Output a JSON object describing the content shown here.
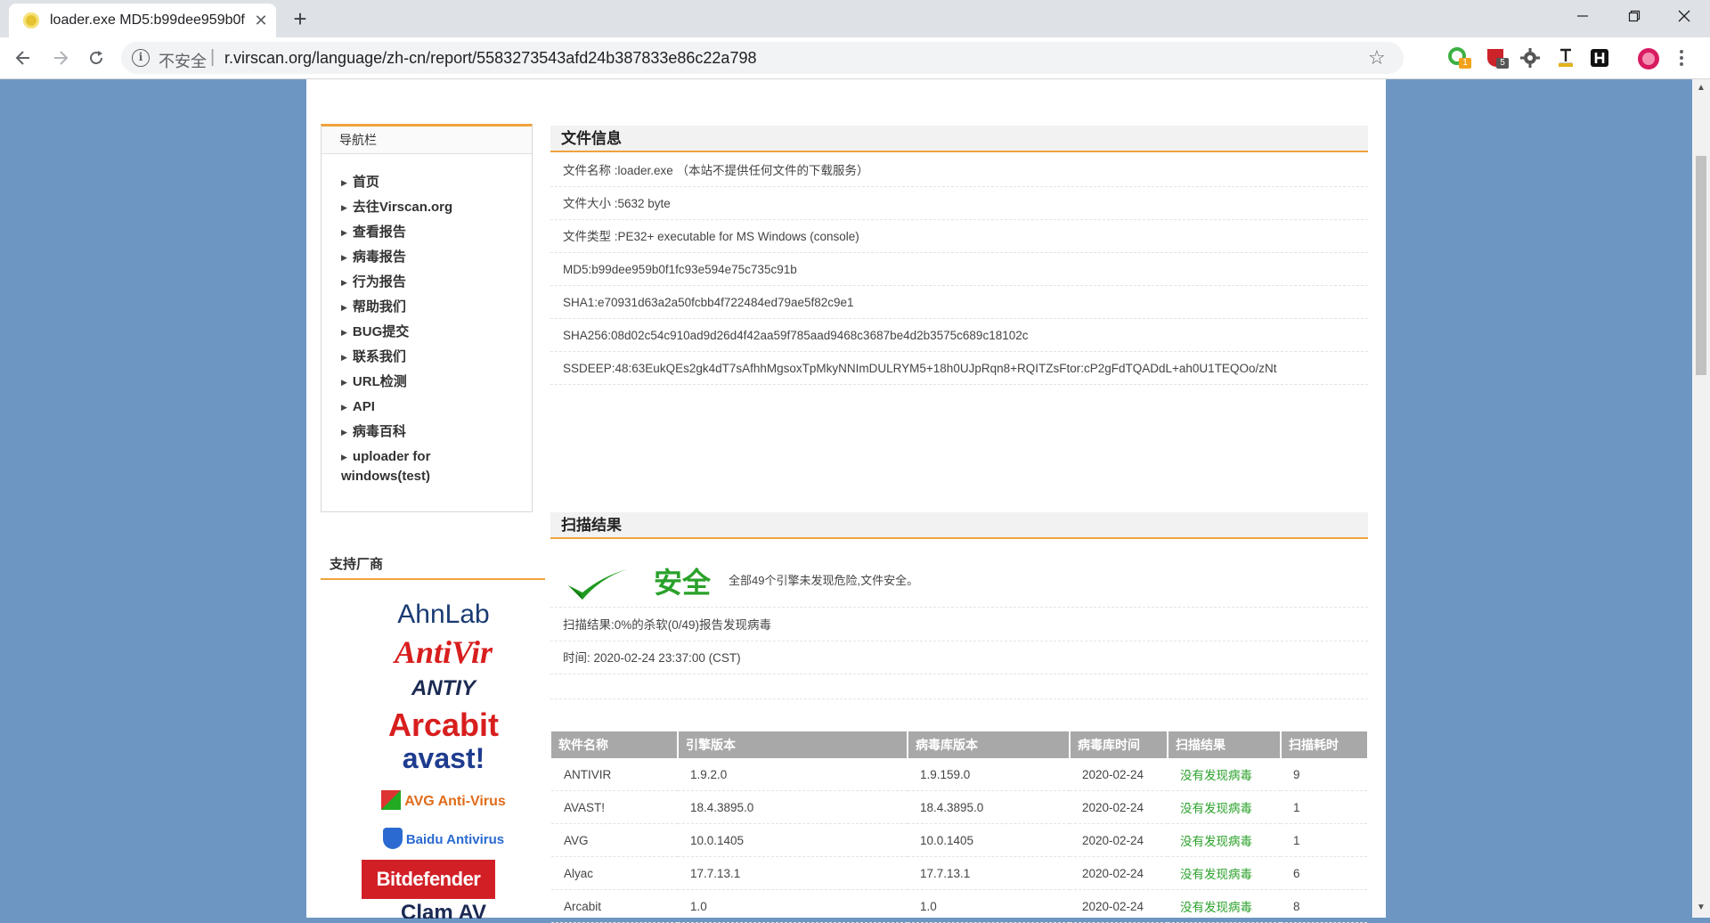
{
  "browser": {
    "tab_title": "loader.exe MD5:b99dee959b0f",
    "tab_close": "✕",
    "new_tab": "+",
    "omnibox": {
      "security_label": "不安全",
      "url": "r.virscan.org/language/zh-cn/report/5583273543afd24b387833e86c22a798"
    },
    "extensions": [
      {
        "name": "extension-1",
        "badge": "1",
        "badge_color": "#f1a11b",
        "color": "#3cb043"
      },
      {
        "name": "extension-2",
        "badge": "5",
        "badge_color": "#555555",
        "color": "#cc2229"
      },
      {
        "name": "extension-3",
        "badge": "",
        "color": "#555555"
      },
      {
        "name": "extension-4",
        "badge": "",
        "color": "#e3b21b"
      },
      {
        "name": "extension-5",
        "badge": "",
        "color": "#111111"
      }
    ]
  },
  "nav": {
    "header": "导航栏",
    "items": [
      {
        "label": "首页"
      },
      {
        "label": "去往Virscan.org"
      },
      {
        "label": "查看报告"
      },
      {
        "label": "病毒报告"
      },
      {
        "label": "行为报告"
      },
      {
        "label": "帮助我们"
      },
      {
        "label": "BUG提交"
      },
      {
        "label": "联系我们"
      },
      {
        "label": "URL检测"
      },
      {
        "label": "API"
      },
      {
        "label": "病毒百科"
      },
      {
        "label": "uploader for windows(test)"
      }
    ]
  },
  "vendors": {
    "header": "支持厂商",
    "items": [
      {
        "name": "AhnLab"
      },
      {
        "name": "AntiVir"
      },
      {
        "name": "ANTIY"
      },
      {
        "name": "Arcabit"
      },
      {
        "name": "avast!"
      },
      {
        "name": "AVG Anti-Virus"
      },
      {
        "name": "Baidu Antivirus"
      },
      {
        "name": "Bitdefender"
      },
      {
        "name": "Clam AV"
      }
    ]
  },
  "file_info": {
    "title": "文件信息",
    "rows": [
      "文件名称 :loader.exe （本站不提供任何文件的下载服务）",
      "文件大小 :5632 byte",
      "文件类型 :PE32+ executable for MS Windows (console)",
      "MD5:b99dee959b0f1fc93e594e75c735c91b",
      "SHA1:e70931d63a2a50fcbb4f722484ed79ae5f82c9e1",
      "SHA256:08d02c54c910ad9d26d4f42aa59f785aad9468c3687be4d2b3575c689c18102c",
      "SSDEEP:48:63EukQEs2gk4dT7sAfhhMgsoxTpMkyNNImDULRYM5+18h0UJpRqn8+RQITZsFtor:cP2gFdTQADdL+ah0U1TEQOo/zNt"
    ]
  },
  "scan": {
    "title": "扫描结果",
    "status": "安全",
    "summary": "全部49个引擎未发现危险,文件安全。",
    "result_line": "扫描结果:0%的杀软(0/49)报告发现病毒",
    "time_line": "时间: 2020-02-24 23:37:00 (CST)",
    "status_color": "#2aa12a"
  },
  "results_table": {
    "headers": [
      "软件名称",
      "引擎版本",
      "病毒库版本",
      "病毒库时间",
      "扫描结果",
      "扫描耗时"
    ],
    "rows": [
      [
        "ANTIVIR",
        "1.9.2.0",
        "1.9.159.0",
        "2020-02-24",
        "没有发现病毒",
        "9"
      ],
      [
        "AVAST!",
        "18.4.3895.0",
        "18.4.3895.0",
        "2020-02-24",
        "没有发现病毒",
        "1"
      ],
      [
        "AVG",
        "10.0.1405",
        "10.0.1405",
        "2020-02-24",
        "没有发现病毒",
        "1"
      ],
      [
        "Alyac",
        "17.7.13.1",
        "17.7.13.1",
        "2020-02-24",
        "没有发现病毒",
        "6"
      ],
      [
        "Arcabit",
        "1.0",
        "1.0",
        "2020-02-24",
        "没有发现病毒",
        "8"
      ]
    ]
  }
}
